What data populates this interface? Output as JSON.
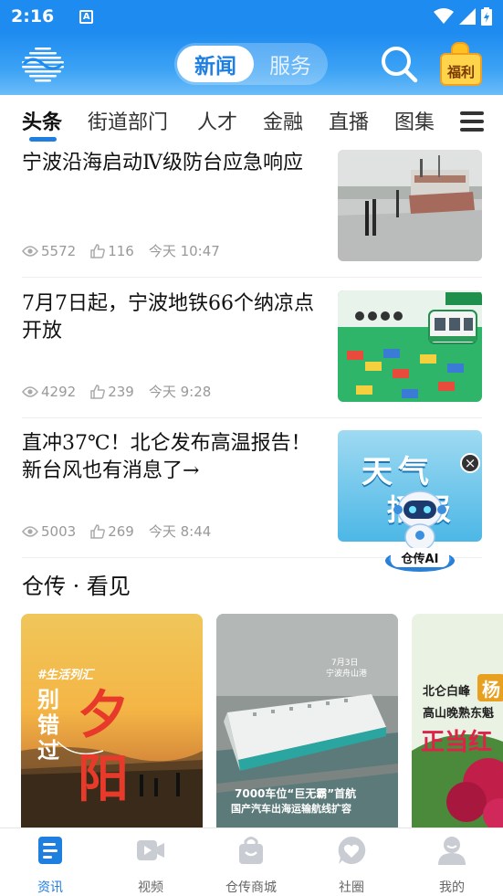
{
  "status_bar": {
    "time": "2:16",
    "notif_letter": "A"
  },
  "header": {
    "segment_active": "新闻",
    "segment_inactive": "服务",
    "fuli_label": "福利"
  },
  "tabs": [
    "头条",
    "街道部门",
    "人才",
    "金融",
    "直播",
    "图集"
  ],
  "articles": [
    {
      "title": "宁波沿海启动Ⅳ级防台应急响应",
      "views": "5572",
      "likes": "116",
      "time": "今天  10:47"
    },
    {
      "title": "7月7日起，宁波地铁66个纳凉点开放",
      "views": "4292",
      "likes": "239",
      "time": "今天  9:28"
    },
    {
      "title": "直冲37℃！北仑发布高温报告！新台风也有消息了→",
      "views": "5003",
      "likes": "269",
      "time": "今天  8:44"
    }
  ],
  "thumb3": {
    "line1": "天气",
    "line2": "播报"
  },
  "ai_badge": "仓传AI",
  "section": {
    "title": "仓传 · 看见"
  },
  "cards": [
    {
      "tag": "#生活列汇",
      "big": "别错过",
      "word": "夕阳"
    },
    {
      "date": "7月3日",
      "place": "宁波舟山港",
      "caption1": "7000车位“巨无霸”首航",
      "caption2": "国产汽车出海运输航线扩容"
    },
    {
      "line1": "北仑白峰",
      "line2": "高山晚熟东魁",
      "red": "正当红",
      "pill": "杨"
    }
  ],
  "bottom_nav": [
    {
      "label": "资讯",
      "icon": "news-icon",
      "active": true
    },
    {
      "label": "视频",
      "icon": "video-icon",
      "active": false
    },
    {
      "label": "仓传商城",
      "icon": "shopping-bag-icon",
      "active": false
    },
    {
      "label": "社圈",
      "icon": "community-icon",
      "active": false
    },
    {
      "label": "我的",
      "icon": "profile-icon",
      "active": false
    }
  ],
  "colors": {
    "accent": "#1e7fe0",
    "header": "#1e8bf0"
  }
}
